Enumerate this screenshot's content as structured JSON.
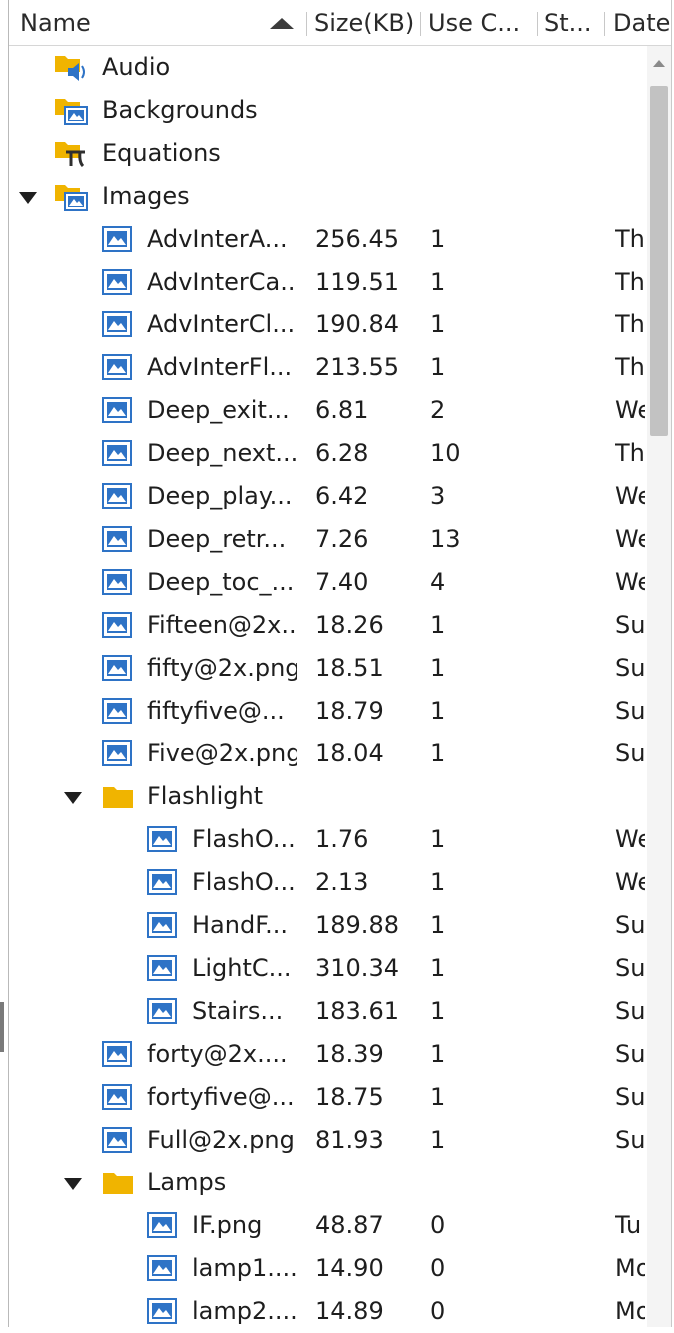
{
  "header": {
    "name_label": "Name",
    "size_label": "Size(KB)",
    "use_label": "Use C...",
    "status_label": "St...",
    "date_label": "Date"
  },
  "colors": {
    "folder": "#f0b400",
    "image_icon": "#2e73c6",
    "header_sep": "#c8c8c8"
  },
  "rows": [
    {
      "indent": 0,
      "expand": false,
      "icon": "audio-folder-icon",
      "name": "Audio",
      "size": "",
      "use": "",
      "date": ""
    },
    {
      "indent": 0,
      "expand": false,
      "icon": "image-folder-icon",
      "name": "Backgrounds",
      "size": "",
      "use": "",
      "date": ""
    },
    {
      "indent": 0,
      "expand": false,
      "icon": "equation-folder-icon",
      "name": "Equations",
      "size": "",
      "use": "",
      "date": ""
    },
    {
      "indent": 0,
      "expand": true,
      "icon": "image-folder-icon",
      "name": "Images",
      "size": "",
      "use": "",
      "date": ""
    },
    {
      "indent": 1,
      "expand": false,
      "icon": "image-file-icon",
      "name": "AdvInterA...",
      "size": "256.45",
      "use": "1",
      "date": "Th"
    },
    {
      "indent": 1,
      "expand": false,
      "icon": "image-file-icon",
      "name": "AdvInterCa...",
      "size": "119.51",
      "use": "1",
      "date": "Th"
    },
    {
      "indent": 1,
      "expand": false,
      "icon": "image-file-icon",
      "name": "AdvInterCl...",
      "size": "190.84",
      "use": "1",
      "date": "Th"
    },
    {
      "indent": 1,
      "expand": false,
      "icon": "image-file-icon",
      "name": "AdvInterFl...",
      "size": "213.55",
      "use": "1",
      "date": "Th"
    },
    {
      "indent": 1,
      "expand": false,
      "icon": "image-file-icon",
      "name": "Deep_exit...",
      "size": "6.81",
      "use": "2",
      "date": "We"
    },
    {
      "indent": 1,
      "expand": false,
      "icon": "image-file-icon",
      "name": "Deep_next...",
      "size": "6.28",
      "use": "10",
      "date": "Th"
    },
    {
      "indent": 1,
      "expand": false,
      "icon": "image-file-icon",
      "name": "Deep_play...",
      "size": "6.42",
      "use": "3",
      "date": "We"
    },
    {
      "indent": 1,
      "expand": false,
      "icon": "image-file-icon",
      "name": "Deep_retr...",
      "size": "7.26",
      "use": "13",
      "date": "We"
    },
    {
      "indent": 1,
      "expand": false,
      "icon": "image-file-icon",
      "name": "Deep_toc_...",
      "size": "7.40",
      "use": "4",
      "date": "We"
    },
    {
      "indent": 1,
      "expand": false,
      "icon": "image-file-icon",
      "name": "Fifteen@2x...",
      "size": "18.26",
      "use": "1",
      "date": "Su"
    },
    {
      "indent": 1,
      "expand": false,
      "icon": "image-file-icon",
      "name": "fifty@2x.png",
      "size": "18.51",
      "use": "1",
      "date": "Su"
    },
    {
      "indent": 1,
      "expand": false,
      "icon": "image-file-icon",
      "name": "fiftyfive@...",
      "size": "18.79",
      "use": "1",
      "date": "Su"
    },
    {
      "indent": 1,
      "expand": false,
      "icon": "image-file-icon",
      "name": "Five@2x.png",
      "size": "18.04",
      "use": "1",
      "date": "Su"
    },
    {
      "indent": 1,
      "expand": true,
      "icon": "folder-icon",
      "name": "Flashlight",
      "size": "",
      "use": "",
      "date": ""
    },
    {
      "indent": 2,
      "expand": false,
      "icon": "image-file-icon",
      "name": "FlashO...",
      "size": "1.76",
      "use": "1",
      "date": "We"
    },
    {
      "indent": 2,
      "expand": false,
      "icon": "image-file-icon",
      "name": "FlashO...",
      "size": "2.13",
      "use": "1",
      "date": "We"
    },
    {
      "indent": 2,
      "expand": false,
      "icon": "image-file-icon",
      "name": "HandF...",
      "size": "189.88",
      "use": "1",
      "date": "Su"
    },
    {
      "indent": 2,
      "expand": false,
      "icon": "image-file-icon",
      "name": "LightC...",
      "size": "310.34",
      "use": "1",
      "date": "Su"
    },
    {
      "indent": 2,
      "expand": false,
      "icon": "image-file-icon",
      "name": "Stairs...",
      "size": "183.61",
      "use": "1",
      "date": "Su"
    },
    {
      "indent": 1,
      "expand": false,
      "icon": "image-file-icon",
      "name": "forty@2x....",
      "size": "18.39",
      "use": "1",
      "date": "Su"
    },
    {
      "indent": 1,
      "expand": false,
      "icon": "image-file-icon",
      "name": "fortyfive@...",
      "size": "18.75",
      "use": "1",
      "date": "Su"
    },
    {
      "indent": 1,
      "expand": false,
      "icon": "image-file-icon",
      "name": "Full@2x.png",
      "size": "81.93",
      "use": "1",
      "date": "Su"
    },
    {
      "indent": 1,
      "expand": true,
      "icon": "folder-icon",
      "name": "Lamps",
      "size": "",
      "use": "",
      "date": ""
    },
    {
      "indent": 2,
      "expand": false,
      "icon": "image-file-icon",
      "name": "IF.png",
      "size": "48.87",
      "use": "0",
      "date": "Tu"
    },
    {
      "indent": 2,
      "expand": false,
      "icon": "image-file-icon",
      "name": "lamp1....",
      "size": "14.90",
      "use": "0",
      "date": "Mo"
    },
    {
      "indent": 2,
      "expand": false,
      "icon": "image-file-icon",
      "name": "lamp2....",
      "size": "14.89",
      "use": "0",
      "date": "Mo"
    }
  ]
}
